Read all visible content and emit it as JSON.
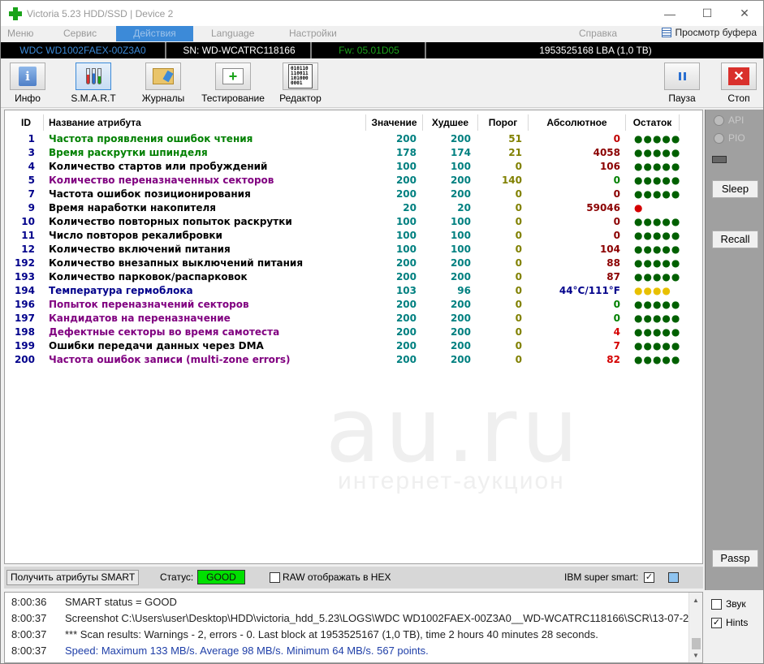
{
  "window": {
    "title": "Victoria 5.23 HDD/SSD | Device 2",
    "minimize": "—",
    "maximize": "☐",
    "close": "✕"
  },
  "menu": {
    "items": [
      "Меню",
      "Сервис",
      "Действия",
      "Language",
      "Настройки"
    ],
    "help": "Справка",
    "clipboard": "Просмотр буфера"
  },
  "infobar": {
    "model": "WDC WD1002FAEX-00Z3A0",
    "serial": "SN: WD-WCATRC118166",
    "firmware": "Fw: 05.01D05",
    "lba": "1953525168 LBA (1,0 TB)",
    "colors": {
      "model": "#3c8ad8",
      "serial": "#ffffff",
      "firmware": "#1aa31a",
      "lba": "#ffffff"
    }
  },
  "toolbar": {
    "info": "Инфо",
    "smart": "S.M.A.R.T",
    "logs": "Журналы",
    "testing": "Тестирование",
    "editor": "Редактор",
    "pause": "Пауза",
    "stop": "Стоп",
    "info_glyph": "i",
    "medkit_glyph": "+",
    "binary_glyph": "010110 110011 101000 0001",
    "stop_glyph": "✕"
  },
  "table": {
    "headers": {
      "id": "ID",
      "name": "Название атрибута",
      "value": "Значение",
      "worst": "Худшее",
      "threshold": "Порог",
      "absolute": "Абсолютное",
      "remaining": "Остаток"
    },
    "rows": [
      {
        "id": "1",
        "name": "Частота проявления ошибок чтения",
        "value": "200",
        "worst": "200",
        "threshold": "51",
        "absolute": "0",
        "dots": "●●●●●",
        "name_color": "#008000",
        "abs_color": "#c00000",
        "dots_color": "#006000"
      },
      {
        "id": "3",
        "name": "Время раскрутки шпинделя",
        "value": "178",
        "worst": "174",
        "threshold": "21",
        "absolute": "4058",
        "dots": "●●●●●",
        "name_color": "#008000",
        "abs_color": "#8b0000",
        "dots_color": "#006000"
      },
      {
        "id": "4",
        "name": "Количество стартов или пробуждений",
        "value": "100",
        "worst": "100",
        "threshold": "0",
        "absolute": "106",
        "dots": "●●●●●",
        "name_color": "#000000",
        "abs_color": "#8b0000",
        "dots_color": "#006000"
      },
      {
        "id": "5",
        "name": "Количество переназначенных секторов",
        "value": "200",
        "worst": "200",
        "threshold": "140",
        "absolute": "0",
        "dots": "●●●●●",
        "name_color": "#800080",
        "abs_color": "#008000",
        "dots_color": "#006000"
      },
      {
        "id": "7",
        "name": "Частота ошибок позиционирования",
        "value": "200",
        "worst": "200",
        "threshold": "0",
        "absolute": "0",
        "dots": "●●●●●",
        "name_color": "#000000",
        "abs_color": "#8b0000",
        "dots_color": "#006000"
      },
      {
        "id": "9",
        "name": "Время наработки накопителя",
        "value": "20",
        "worst": "20",
        "threshold": "0",
        "absolute": "59046",
        "dots": "●",
        "name_color": "#000000",
        "abs_color": "#8b0000",
        "dots_color": "#d40000"
      },
      {
        "id": "10",
        "name": "Количество повторных попыток раскрутки",
        "value": "100",
        "worst": "100",
        "threshold": "0",
        "absolute": "0",
        "dots": "●●●●●",
        "name_color": "#000000",
        "abs_color": "#8b0000",
        "dots_color": "#006000"
      },
      {
        "id": "11",
        "name": "Число повторов рекалибровки",
        "value": "100",
        "worst": "100",
        "threshold": "0",
        "absolute": "0",
        "dots": "●●●●●",
        "name_color": "#000000",
        "abs_color": "#8b0000",
        "dots_color": "#006000"
      },
      {
        "id": "12",
        "name": "Количество включений питания",
        "value": "100",
        "worst": "100",
        "threshold": "0",
        "absolute": "104",
        "dots": "●●●●●",
        "name_color": "#000000",
        "abs_color": "#8b0000",
        "dots_color": "#006000"
      },
      {
        "id": "192",
        "name": "Количество внезапных выключений питания",
        "value": "200",
        "worst": "200",
        "threshold": "0",
        "absolute": "88",
        "dots": "●●●●●",
        "name_color": "#000000",
        "abs_color": "#8b0000",
        "dots_color": "#006000"
      },
      {
        "id": "193",
        "name": "Количество парковок/распарковок",
        "value": "200",
        "worst": "200",
        "threshold": "0",
        "absolute": "87",
        "dots": "●●●●●",
        "name_color": "#000000",
        "abs_color": "#8b0000",
        "dots_color": "#006000"
      },
      {
        "id": "194",
        "name": "Температура гермоблока",
        "value": "103",
        "worst": "96",
        "threshold": "0",
        "absolute": "44°C/111°F",
        "dots": "●●●●",
        "name_color": "#00008b",
        "abs_color": "#00008b",
        "dots_color": "#e8c000"
      },
      {
        "id": "196",
        "name": "Попыток переназначений секторов",
        "value": "200",
        "worst": "200",
        "threshold": "0",
        "absolute": "0",
        "dots": "●●●●●",
        "name_color": "#800080",
        "abs_color": "#008000",
        "dots_color": "#006000"
      },
      {
        "id": "197",
        "name": "Кандидатов на переназначение",
        "value": "200",
        "worst": "200",
        "threshold": "0",
        "absolute": "0",
        "dots": "●●●●●",
        "name_color": "#800080",
        "abs_color": "#008000",
        "dots_color": "#006000"
      },
      {
        "id": "198",
        "name": "Дефектные секторы во время самотеста",
        "value": "200",
        "worst": "200",
        "threshold": "0",
        "absolute": "4",
        "dots": "●●●●●",
        "name_color": "#800080",
        "abs_color": "#d40000",
        "dots_color": "#006000"
      },
      {
        "id": "199",
        "name": "Ошибки передачи данных через DMA",
        "value": "200",
        "worst": "200",
        "threshold": "0",
        "absolute": "7",
        "dots": "●●●●●",
        "name_color": "#000000",
        "abs_color": "#d40000",
        "dots_color": "#006000"
      },
      {
        "id": "200",
        "name": "Частота ошибок записи (multi-zone errors)",
        "value": "200",
        "worst": "200",
        "threshold": "0",
        "absolute": "82",
        "dots": "●●●●●",
        "name_color": "#800080",
        "abs_color": "#d40000",
        "dots_color": "#006000"
      }
    ],
    "colors": {
      "id": "#00008b",
      "value": "#008080",
      "threshold": "#808000"
    }
  },
  "watermark": {
    "line1": "au.ru",
    "line2": "интернет-аукцион"
  },
  "side": {
    "api": "API",
    "pio": "PIO",
    "sleep": "Sleep",
    "recall": "Recall",
    "passp": "Passp"
  },
  "statusbar": {
    "get_smart": "Получить атрибуты SMART",
    "status_label": "Статус:",
    "status_value": "GOOD",
    "raw_hex": "RAW отображать в HEX",
    "ibm": "IBM super smart:",
    "ibm_checked": "✓"
  },
  "log": [
    {
      "time": "8:00:36",
      "msg": "SMART status = GOOD",
      "color": "#222222"
    },
    {
      "time": "8:00:37",
      "msg": "Screenshot C:\\Users\\user\\Desktop\\HDD\\victoria_hdd_5.23\\LOGS\\WDC WD1002FAEX-00Z3A0__WD-WCATRC118166\\SCR\\13-07-2...",
      "color": "#222222"
    },
    {
      "time": "8:00:37",
      "msg": "*** Scan results: Warnings - 2, errors - 0. Last block at 1953525167 (1,0 TB), time 2 hours 40 minutes 28 seconds.",
      "color": "#222222"
    },
    {
      "time": "8:00:37",
      "msg": "Speed: Maximum 133 MB/s. Average 98 MB/s. Minimum 64 MB/s. 567 points.",
      "color": "#1f3fa8"
    }
  ],
  "scroll": {
    "up": "▲",
    "down": "▼"
  },
  "options": {
    "sound": "Звук",
    "sound_checked": "",
    "hints": "Hints",
    "hints_checked": "✓"
  }
}
